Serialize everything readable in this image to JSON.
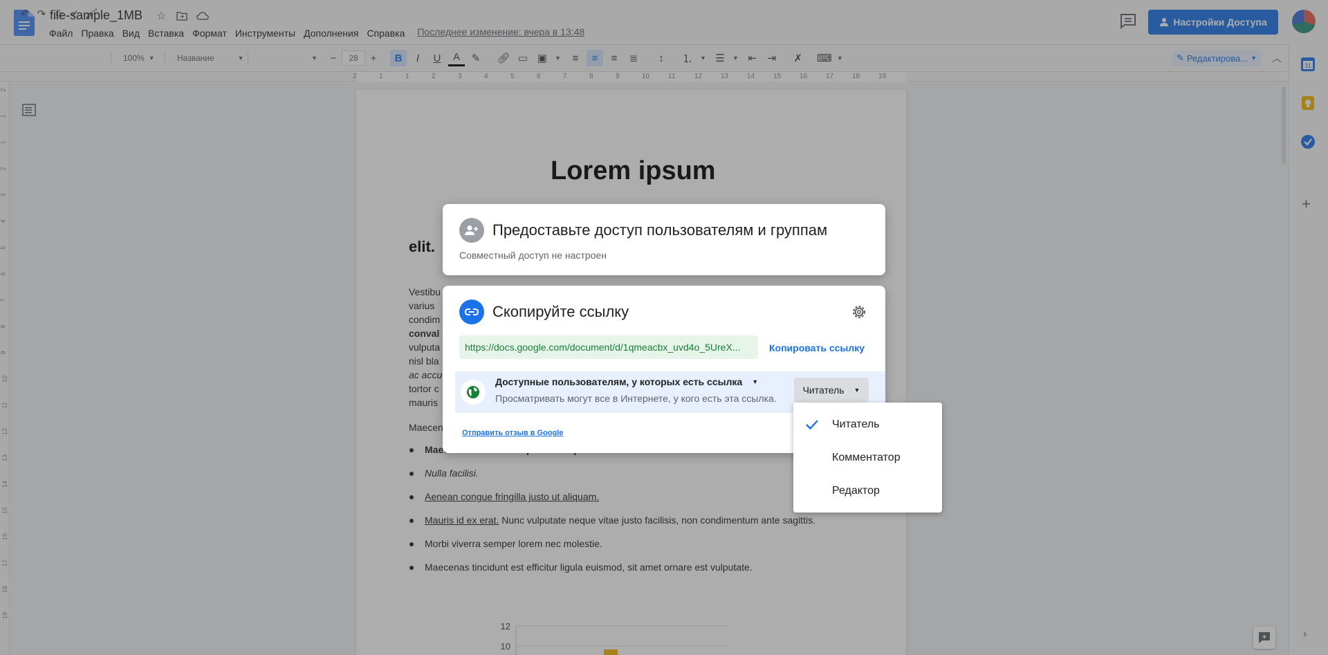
{
  "app": {
    "doc_title": "file-sample_1MB",
    "menu": [
      "Файл",
      "Правка",
      "Вид",
      "Вставка",
      "Формат",
      "Инструменты",
      "Дополнения",
      "Справка"
    ],
    "last_edit": "Последнее изменение: вчера в 13:48",
    "share_label": "Настройки Доступа",
    "brand_color": "#1a73e8"
  },
  "toolbar": {
    "zoom": "100%",
    "style": "Название",
    "font_size": "28",
    "font_minus": "−",
    "font_plus": "+",
    "bold": "B",
    "italic": "I",
    "underline": "U",
    "text_color": "A",
    "editing_mode": "Редактирова..."
  },
  "ruler": {
    "horizontal": [
      "2",
      "1",
      "1",
      "2",
      "3",
      "4",
      "5",
      "6",
      "7",
      "8",
      "9",
      "10",
      "11",
      "12",
      "13",
      "14",
      "15",
      "16",
      "17",
      "18",
      "19"
    ],
    "vertical": [
      "2",
      "1",
      "1",
      "2",
      "3",
      "4",
      "5",
      "6",
      "7",
      "8",
      "9",
      "10",
      "11",
      "12",
      "13",
      "14",
      "15",
      "16",
      "17",
      "18",
      "19"
    ]
  },
  "document": {
    "title": "Lorem ipsum",
    "heading_fragment": "elit.",
    "para_fragments": [
      "Vestibu",
      "varius",
      "condim",
      "conval",
      "vulputa",
      "nisl bla",
      "ac accu",
      "tortor c",
      "mauris"
    ],
    "para2_fragment": "Maecen",
    "bullets": [
      {
        "text": "Maecenas non lorem quis tellus placerat varius.",
        "style": "b"
      },
      {
        "text": "Nulla facilisi.",
        "style": "i"
      },
      {
        "text": "Aenean congue fringilla justo ut aliquam.",
        "style": "u"
      },
      {
        "lead": "Mauris id ex erat.",
        "text": " Nunc vulputate neque vitae justo facilisis, non condimentum ante sagittis.",
        "style": "mix"
      },
      {
        "text": "Morbi viverra semper lorem nec molestie.",
        "style": ""
      },
      {
        "text": "Maecenas tincidunt est efficitur ligula euismod, sit amet ornare est vulputate.",
        "style": ""
      }
    ],
    "chart_ticks": [
      "12",
      "10"
    ]
  },
  "share_dialog": {
    "people_title": "Предоставьте доступ пользователям и группам",
    "people_sub": "Совместный доступ не настроен",
    "link_title": "Скопируйте ссылку",
    "link_url": "https://docs.google.com/document/d/1qmeacbx_uvd4o_5UreX...",
    "copy_link": "Копировать ссылку",
    "access_scope": "Доступные пользователям, у которых есть ссылка",
    "access_desc": "Просматривать могут все в Интернете, у кого есть эта ссылка.",
    "role": "Читатель",
    "feedback": "Отправить отзыв в Google"
  },
  "role_menu": {
    "items": [
      "Читатель",
      "Комментатор",
      "Редактор"
    ],
    "selected": "Читатель"
  }
}
